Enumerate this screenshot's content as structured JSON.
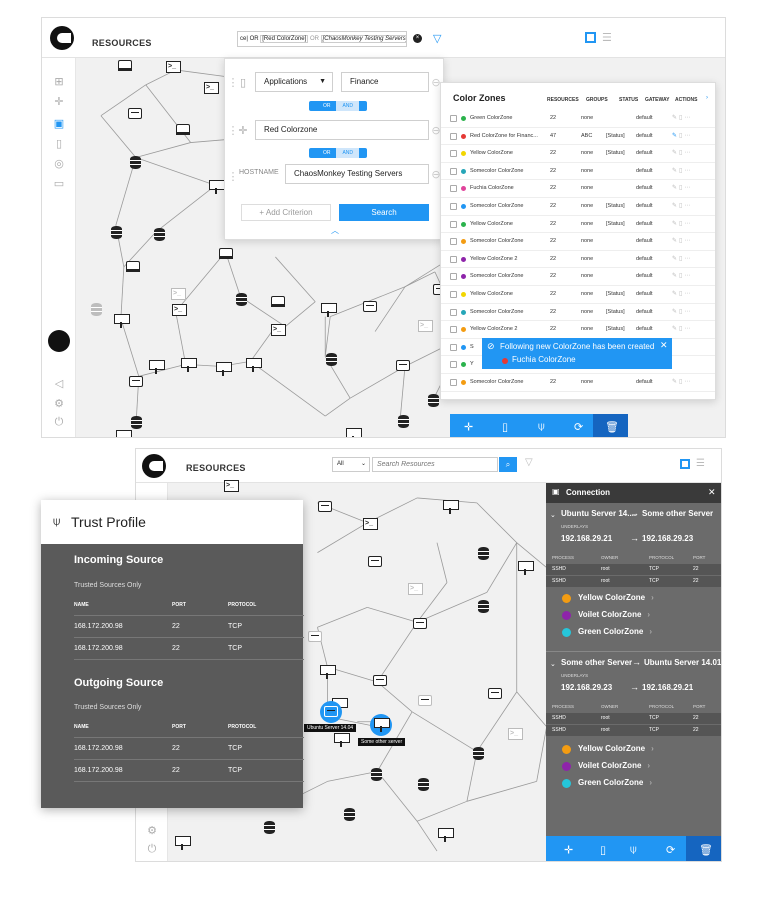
{
  "top": {
    "resources_label": "RESOURCES",
    "query_parts": [
      "ce| OR",
      "[Red ColorZone]",
      "OR",
      "[ChaosMonkey Testing Servers]"
    ],
    "criteria": {
      "row1_select": "Applications",
      "row1_value": "Finance",
      "row2_value": "Red Colorzone",
      "row3_label": "HOSTNAME",
      "row3_value": "ChaosMonkey Testing Servers",
      "or_label": "OR",
      "and_label": "AND",
      "add_label": "+ Add Criterion",
      "search_label": "Search"
    },
    "color_zones": {
      "title": "Color Zones",
      "headers": [
        "RESOURCES",
        "GROUPS",
        "STATUS",
        "GATEWAY",
        "ACTIONS"
      ],
      "rows": [
        {
          "name": "Green ColorZone",
          "color": "#2bb24c",
          "res": "22",
          "groups": "none",
          "status": "",
          "gateway": "default"
        },
        {
          "name": "Red ColorZone for Financ...",
          "color": "#e53935",
          "res": "47",
          "groups": "ABC",
          "status": "[Status]",
          "gateway": "default"
        },
        {
          "name": "Yellow ColorZone",
          "color": "#f2d600",
          "res": "22",
          "groups": "none",
          "status": "[Status]",
          "gateway": "default"
        },
        {
          "name": "Somecolor ColorZone",
          "color": "#26a6b8",
          "res": "22",
          "groups": "none",
          "status": "",
          "gateway": "default"
        },
        {
          "name": "Fuchia ColorZone",
          "color": "#e0449b",
          "res": "22",
          "groups": "none",
          "status": "",
          "gateway": "default"
        },
        {
          "name": "Somecolor ColorZone",
          "color": "#2196f3",
          "res": "22",
          "groups": "none",
          "status": "[Status]",
          "gateway": "default"
        },
        {
          "name": "Yellow ColorZone",
          "color": "#2bb24c",
          "res": "22",
          "groups": "none",
          "status": "[Status]",
          "gateway": "default"
        },
        {
          "name": "Somecolor ColorZone",
          "color": "#f39c12",
          "res": "22",
          "groups": "none",
          "status": "",
          "gateway": "default"
        },
        {
          "name": "Yellow ColorZone 2",
          "color": "#8e24aa",
          "res": "22",
          "groups": "none",
          "status": "",
          "gateway": "default"
        },
        {
          "name": "Somecolor ColorZone",
          "color": "#8e24aa",
          "res": "22",
          "groups": "none",
          "status": "",
          "gateway": "default"
        },
        {
          "name": "Yellow ColorZone",
          "color": "#f2d600",
          "res": "22",
          "groups": "none",
          "status": "[Status]",
          "gateway": "default"
        },
        {
          "name": "Somecolor ColorZone",
          "color": "#26a6b8",
          "res": "22",
          "groups": "none",
          "status": "[Status]",
          "gateway": "default"
        },
        {
          "name": "Yellow ColorZone 2",
          "color": "#f39c12",
          "res": "22",
          "groups": "none",
          "status": "[Status]",
          "gateway": "default"
        },
        {
          "name": "S",
          "color": "#2196f3",
          "res": "",
          "groups": "",
          "status": "",
          "gateway": ""
        },
        {
          "name": "Y",
          "color": "#2bb24c",
          "res": "",
          "groups": "",
          "status": "",
          "gateway": ""
        },
        {
          "name": "Somecolor ColorZone",
          "color": "#f39c12",
          "res": "22",
          "groups": "none",
          "status": "",
          "gateway": "default"
        }
      ]
    },
    "toast": {
      "line1": "Following new ColorZone has been created",
      "line2": "Fuchia ColorZone",
      "dot_color": "#e53935"
    }
  },
  "bottom": {
    "resources_label": "RESOURCES",
    "filter_select": "All",
    "search_placeholder": "Search Resources",
    "trust": {
      "title": "Trust Profile",
      "incoming_title": "Incoming Source",
      "incoming_sub": "Trusted Sources Only",
      "outgoing_title": "Outgoing Source",
      "outgoing_sub": "Trusted Sources Only",
      "cols": [
        "NAME",
        "PORT",
        "PROTOCOL"
      ],
      "incoming_rows": [
        {
          "name": "168.172.200.98",
          "port": "22",
          "protocol": "TCP"
        },
        {
          "name": "168.172.200.98",
          "port": "22",
          "protocol": "TCP"
        }
      ],
      "outgoing_rows": [
        {
          "name": "168.172.200.98",
          "port": "22",
          "protocol": "TCP"
        },
        {
          "name": "168.172.200.98",
          "port": "22",
          "protocol": "TCP"
        }
      ]
    },
    "nodes": {
      "a_label": "Ubuntu Server 14.04",
      "b_label": "Some other server"
    },
    "connection": {
      "title": "Connection",
      "c1_from": "Ubuntu Server 14....",
      "c1_to": "Some other Server",
      "c1_underlay": "UNDERLAYS",
      "c1_ip_from": "192.168.29.21",
      "c1_ip_to": "192.168.29.23",
      "c2_from": "Some other Server",
      "c2_to": "Ubuntu Server 14.01",
      "c2_underlay": "UNDERLAYS",
      "c2_ip_from": "192.168.29.23",
      "c2_ip_to": "192.168.29.21",
      "proc_cols": [
        "PROCESS",
        "OWNER",
        "PROTOCOL",
        "PORT"
      ],
      "c1_procs": [
        {
          "process": "SSHD",
          "owner": "root",
          "protocol": "TCP",
          "port": "22"
        },
        {
          "process": "SSHD",
          "owner": "root",
          "protocol": "TCP",
          "port": "22"
        }
      ],
      "c2_procs": [
        {
          "process": "SSHD",
          "owner": "root",
          "protocol": "TCP",
          "port": "22"
        },
        {
          "process": "SSHD",
          "owner": "root",
          "protocol": "TCP",
          "port": "22"
        }
      ],
      "zones": [
        {
          "name": "Yellow ColorZone",
          "color": "#f39c12"
        },
        {
          "name": "Voilet ColorZone",
          "color": "#8e24aa"
        },
        {
          "name": "Green ColorZone",
          "color": "#26c6da"
        }
      ]
    }
  }
}
